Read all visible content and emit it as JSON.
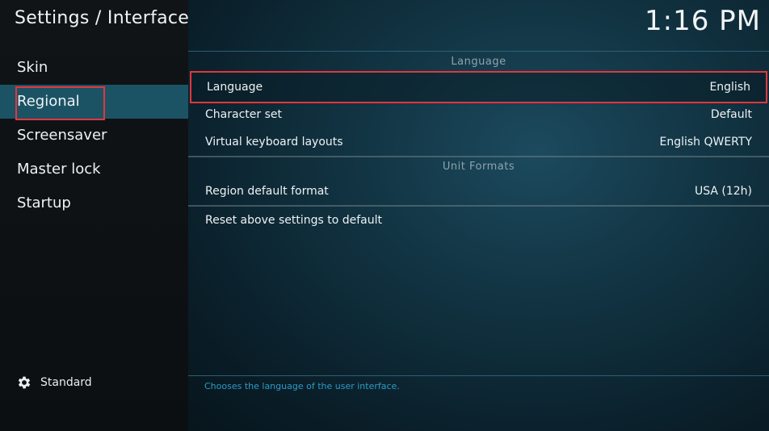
{
  "header": {
    "title": "Settings / Interface",
    "clock": "1:16 PM"
  },
  "sidebar": {
    "items": [
      {
        "label": "Skin"
      },
      {
        "label": "Regional"
      },
      {
        "label": "Screensaver"
      },
      {
        "label": "Master lock"
      },
      {
        "label": "Startup"
      }
    ],
    "settings_level": "Standard"
  },
  "sections": [
    {
      "title": "Language",
      "rows": [
        {
          "label": "Language",
          "value": "English"
        },
        {
          "label": "Character set",
          "value": "Default"
        },
        {
          "label": "Virtual keyboard layouts",
          "value": "English QWERTY"
        }
      ]
    },
    {
      "title": "Unit Formats",
      "rows": [
        {
          "label": "Region default format",
          "value": "USA (12h)"
        }
      ]
    }
  ],
  "reset_label": "Reset above settings to default",
  "description": "Chooses the language of the user interface.",
  "colors": {
    "accent_highlight": "#e0373d",
    "active_bg": "#1b5365",
    "description_text": "#2c9bc6"
  }
}
